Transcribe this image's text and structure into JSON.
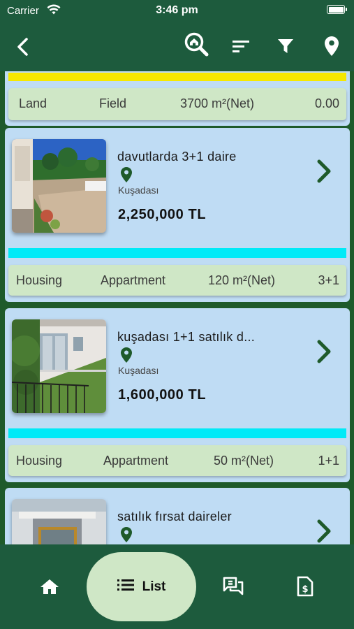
{
  "status_bar": {
    "carrier": "Carrier",
    "time": "3:46 pm"
  },
  "app_bar": {
    "icons": [
      "back-arrow-icon",
      "house-search-icon",
      "sort-icon",
      "filter-icon",
      "location-pin-icon"
    ]
  },
  "listings": [
    {
      "title": "",
      "location": "",
      "price": "",
      "bar_color": "#f5e800",
      "specs": {
        "type": "Land",
        "subtype": "Field",
        "area": "3700 m²(Net)",
        "rooms": "0.00"
      }
    },
    {
      "title": "davutlarda 3+1 daire",
      "location": "Kuşadası",
      "price": "2,250,000 TL",
      "bar_color": "#00eaf7",
      "specs": {
        "type": "Housing",
        "subtype": "Appartment",
        "area": "120 m²(Net)",
        "rooms": "3+1"
      }
    },
    {
      "title": "kuşadası 1+1 satılık d...",
      "location": "Kuşadası",
      "price": "1,600,000 TL",
      "bar_color": "#00eaf7",
      "specs": {
        "type": "Housing",
        "subtype": "Appartment",
        "area": "50 m²(Net)",
        "rooms": "1+1"
      }
    },
    {
      "title": "satılık fırsat daireler",
      "location": "",
      "price": "",
      "bar_color": "#00eaf7",
      "specs": {}
    }
  ],
  "bottom_nav": {
    "items": [
      {
        "icon": "home-icon",
        "label": ""
      },
      {
        "icon": "list-icon",
        "label": "List",
        "active": true
      },
      {
        "icon": "chat-icon",
        "label": ""
      },
      {
        "icon": "document-price-icon",
        "label": ""
      }
    ]
  },
  "colors": {
    "primary": "#1d5b3d",
    "background": "#1e5a2a",
    "card": "#bfdcf4",
    "specs": "#cfe7c6",
    "accent_bar": "#00eaf7",
    "icon_green": "#1e5a2a"
  }
}
